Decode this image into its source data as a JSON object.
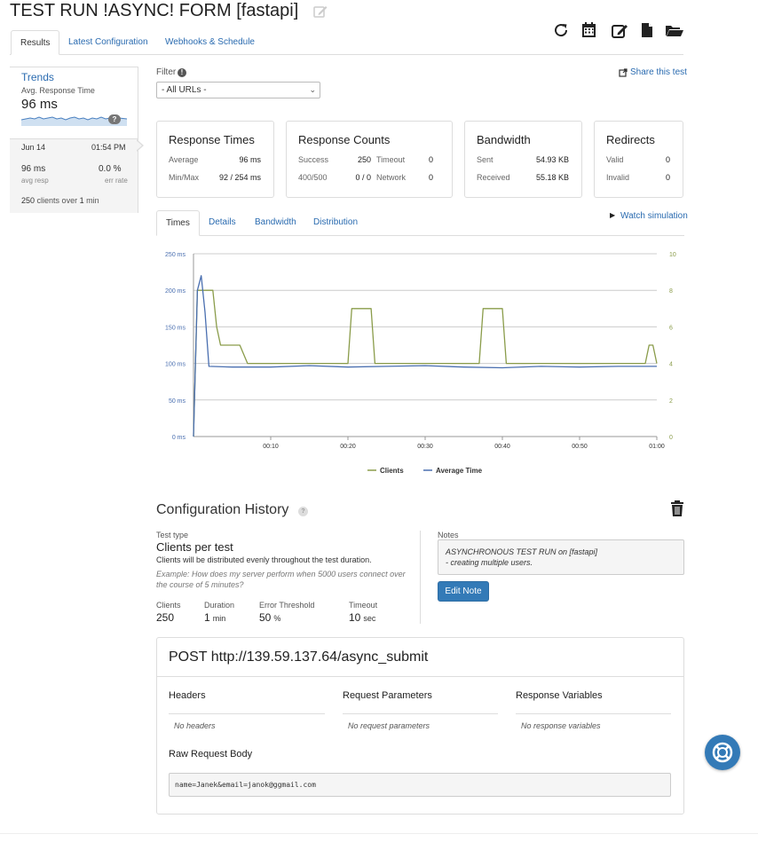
{
  "header": {
    "title": "TEST RUN !ASYNC! FORM [fastapi]"
  },
  "tabs": [
    {
      "label": "Results"
    },
    {
      "label": "Latest Configuration"
    },
    {
      "label": "Webhooks & Schedule"
    }
  ],
  "toolbar": {
    "icons": [
      "refresh-icon",
      "calendar-icon",
      "edit-icon",
      "file-icon",
      "folder-open-icon"
    ]
  },
  "trends": {
    "title": "Trends",
    "metric_label": "Avg. Response Time",
    "metric_value": "96 ms",
    "help": "?",
    "date": "Jun 14",
    "time": "01:54 PM",
    "avg_resp_value": "96 ms",
    "avg_resp_label": "avg resp",
    "err_rate_value": "0.0 %",
    "err_rate_label": "err rate",
    "clients_count": "250",
    "clients_text_1": "clients over",
    "clients_duration": "1",
    "clients_text_2": "min"
  },
  "filter": {
    "label": "Filter",
    "selected": "- All URLs -"
  },
  "share_label": "Share this test",
  "cards": {
    "response_times": {
      "title": "Response Times",
      "average_label": "Average",
      "average_value": "96 ms",
      "minmax_label": "Min/Max",
      "minmax_value": "92 / 254 ms"
    },
    "response_counts": {
      "title": "Response Counts",
      "success_label": "Success",
      "success_value": "250",
      "timeout_label": "Timeout",
      "timeout_value": "0",
      "r400_label": "400/500",
      "r400_value": "0 / 0",
      "network_label": "Network",
      "network_value": "0"
    },
    "bandwidth": {
      "title": "Bandwidth",
      "sent_label": "Sent",
      "sent_value": "54.93 KB",
      "received_label": "Received",
      "received_value": "55.18 KB"
    },
    "redirects": {
      "title": "Redirects",
      "valid_label": "Valid",
      "valid_value": "0",
      "invalid_label": "Invalid",
      "invalid_value": "0"
    }
  },
  "chart_tabs": [
    {
      "label": "Times"
    },
    {
      "label": "Details"
    },
    {
      "label": "Bandwidth"
    },
    {
      "label": "Distribution"
    }
  ],
  "watch_label": "Watch simulation",
  "chart_data": {
    "type": "line",
    "x_ticks": [
      "00:10",
      "00:20",
      "00:30",
      "00:40",
      "00:50",
      "01:00"
    ],
    "y_left_ticks": [
      "0 ms",
      "50 ms",
      "100 ms",
      "150 ms",
      "200 ms",
      "250 ms"
    ],
    "y_right_ticks": [
      "0",
      "2",
      "4",
      "6",
      "8",
      "10"
    ],
    "ylim_left": [
      0,
      250
    ],
    "ylim_right": [
      0,
      10
    ],
    "xlim_seconds": [
      0,
      60
    ],
    "grid": true,
    "legend_position": "bottom",
    "series": [
      {
        "name": "Clients",
        "color": "#8a9c4a",
        "axis": "right",
        "x": [
          0,
          0.5,
          1,
          2.5,
          3,
          3.5,
          4,
          6,
          7,
          20,
          20.5,
          21,
          23,
          23.5,
          24,
          37,
          37.5,
          38,
          40,
          40.5,
          41,
          58.5,
          59,
          59.5,
          60
        ],
        "y": [
          0,
          8,
          8,
          8,
          6,
          5,
          5,
          5,
          4,
          4,
          7,
          7,
          7,
          4,
          4,
          4,
          7,
          7,
          7,
          4,
          4,
          4,
          5,
          5,
          4
        ]
      },
      {
        "name": "Average Time",
        "color": "#4a6fb0",
        "axis": "left",
        "x": [
          0,
          0.5,
          1,
          1.5,
          2,
          5,
          10,
          15,
          20,
          25,
          30,
          35,
          40,
          45,
          50,
          55,
          60
        ],
        "y": [
          0,
          200,
          220,
          170,
          96,
          95,
          95,
          97,
          95,
          96,
          97,
          95,
          94,
          96,
          95,
          96,
          96
        ]
      }
    ]
  },
  "config_history": {
    "title": "Configuration History",
    "help": "?",
    "test_type_label": "Test type",
    "test_type_value": "Clients per test",
    "test_type_desc": "Clients will be distributed evenly throughout the test duration.",
    "example": "Example: How does my server perform when 5000 users connect over the course of 5 minutes?",
    "clients_label": "Clients",
    "clients_value": "250",
    "duration_label": "Duration",
    "duration_value": "1",
    "duration_unit": "min",
    "error_label": "Error Threshold",
    "error_value": "50",
    "error_unit": "%",
    "timeout_label": "Timeout",
    "timeout_value": "10",
    "timeout_unit": "sec",
    "notes_label": "Notes",
    "notes_line1": "ASYNCHRONOUS TEST RUN on [fastapi]",
    "notes_line2": "- creating multiple users.",
    "edit_note_button": "Edit Note"
  },
  "request": {
    "title": "POST http://139.59.137.64/async_submit",
    "headers_label": "Headers",
    "headers_empty": "No headers",
    "params_label": "Request Parameters",
    "params_empty": "No request parameters",
    "vars_label": "Response Variables",
    "vars_empty": "No response variables",
    "raw_body_label": "Raw Request Body",
    "raw_body": "name=Janek&email=janok@ggmail.com"
  },
  "colors": {
    "link": "#2a6bb0",
    "primary": "#337ab7",
    "clients_line": "#8a9c4a",
    "avg_time_line": "#4a6fb0"
  }
}
